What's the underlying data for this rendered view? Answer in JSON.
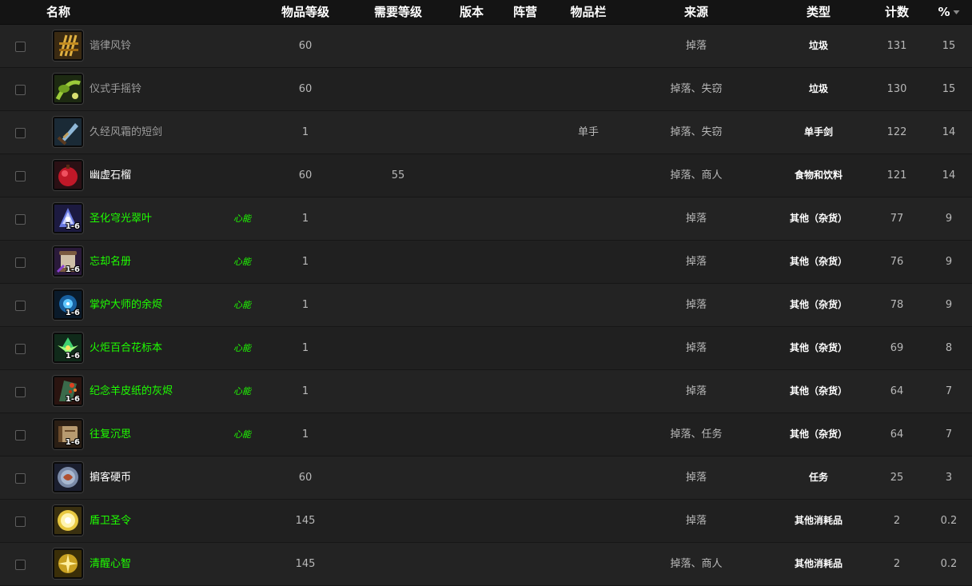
{
  "columns": {
    "name": "名称",
    "item_level": "物品等级",
    "req_level": "需要等级",
    "version": "版本",
    "faction": "阵营",
    "slot": "物品栏",
    "source": "来源",
    "type": "类型",
    "count": "计数",
    "percent": "%"
  },
  "quality_colors": {
    "gray": "#9d9d9d",
    "white": "#ffffff",
    "green": "#1eff00"
  },
  "rows": [
    {
      "name": "谐律风铃",
      "quality": "gray",
      "icon": "wind-chimes-icon",
      "tag": "",
      "stack": "",
      "ilvl": "60",
      "req": "",
      "slot": "",
      "source": "掉落",
      "type": "垃圾",
      "count": "131",
      "pct": "15"
    },
    {
      "name": "仪式手摇铃",
      "quality": "gray",
      "icon": "hand-bell-icon",
      "tag": "",
      "stack": "",
      "ilvl": "60",
      "req": "",
      "slot": "",
      "source": "掉落、失窃",
      "type": "垃圾",
      "count": "130",
      "pct": "15"
    },
    {
      "name": "久经风霜的短剑",
      "quality": "gray",
      "icon": "short-sword-icon",
      "tag": "",
      "stack": "",
      "ilvl": "1",
      "req": "",
      "slot": "单手",
      "source": "掉落、失窃",
      "type": "单手剑",
      "count": "122",
      "pct": "14"
    },
    {
      "name": "幽虚石榴",
      "quality": "white",
      "icon": "pomegranate-icon",
      "tag": "",
      "stack": "",
      "ilvl": "60",
      "req": "55",
      "slot": "",
      "source": "掉落、商人",
      "type": "食物和饮料",
      "count": "121",
      "pct": "14"
    },
    {
      "name": "圣化穹光翠叶",
      "quality": "green",
      "icon": "crystal-leaf-icon",
      "tag": "心能",
      "stack": "1-6",
      "ilvl": "1",
      "req": "",
      "slot": "",
      "source": "掉落",
      "type": "其他（杂货）",
      "count": "77",
      "pct": "9"
    },
    {
      "name": "忘却名册",
      "quality": "green",
      "icon": "scroll-icon",
      "tag": "心能",
      "stack": "1-6",
      "ilvl": "1",
      "req": "",
      "slot": "",
      "source": "掉落",
      "type": "其他（杂货）",
      "count": "76",
      "pct": "9"
    },
    {
      "name": "掌炉大师的余烬",
      "quality": "green",
      "icon": "blue-ember-icon",
      "tag": "心能",
      "stack": "1-6",
      "ilvl": "1",
      "req": "",
      "slot": "",
      "source": "掉落",
      "type": "其他（杂货）",
      "count": "78",
      "pct": "9"
    },
    {
      "name": "火炬百合花标本",
      "quality": "green",
      "icon": "lily-flower-icon",
      "tag": "心能",
      "stack": "1-6",
      "ilvl": "1",
      "req": "",
      "slot": "",
      "source": "掉落",
      "type": "其他（杂货）",
      "count": "69",
      "pct": "8"
    },
    {
      "name": "纪念羊皮纸的灰烬",
      "quality": "green",
      "icon": "parchment-ash-icon",
      "tag": "心能",
      "stack": "1-6",
      "ilvl": "1",
      "req": "",
      "slot": "",
      "source": "掉落",
      "type": "其他（杂货）",
      "count": "64",
      "pct": "7"
    },
    {
      "name": "往复沉思",
      "quality": "green",
      "icon": "tome-icon",
      "tag": "心能",
      "stack": "1-6",
      "ilvl": "1",
      "req": "",
      "slot": "",
      "source": "掉落、任务",
      "type": "其他（杂货）",
      "count": "64",
      "pct": "7"
    },
    {
      "name": "掮客硬币",
      "quality": "white",
      "icon": "broker-coin-icon",
      "tag": "",
      "stack": "",
      "ilvl": "60",
      "req": "",
      "slot": "",
      "source": "掉落",
      "type": "任务",
      "count": "25",
      "pct": "3"
    },
    {
      "name": "盾卫圣令",
      "quality": "green",
      "icon": "holy-seal-icon",
      "tag": "",
      "stack": "",
      "ilvl": "145",
      "req": "",
      "slot": "",
      "source": "掉落",
      "type": "其他消耗品",
      "count": "2",
      "pct": "0.2"
    },
    {
      "name": "清醒心智",
      "quality": "green",
      "icon": "golden-mind-icon",
      "tag": "",
      "stack": "",
      "ilvl": "145",
      "req": "",
      "slot": "",
      "source": "掉落、商人",
      "type": "其他消耗品",
      "count": "2",
      "pct": "0.2"
    }
  ]
}
